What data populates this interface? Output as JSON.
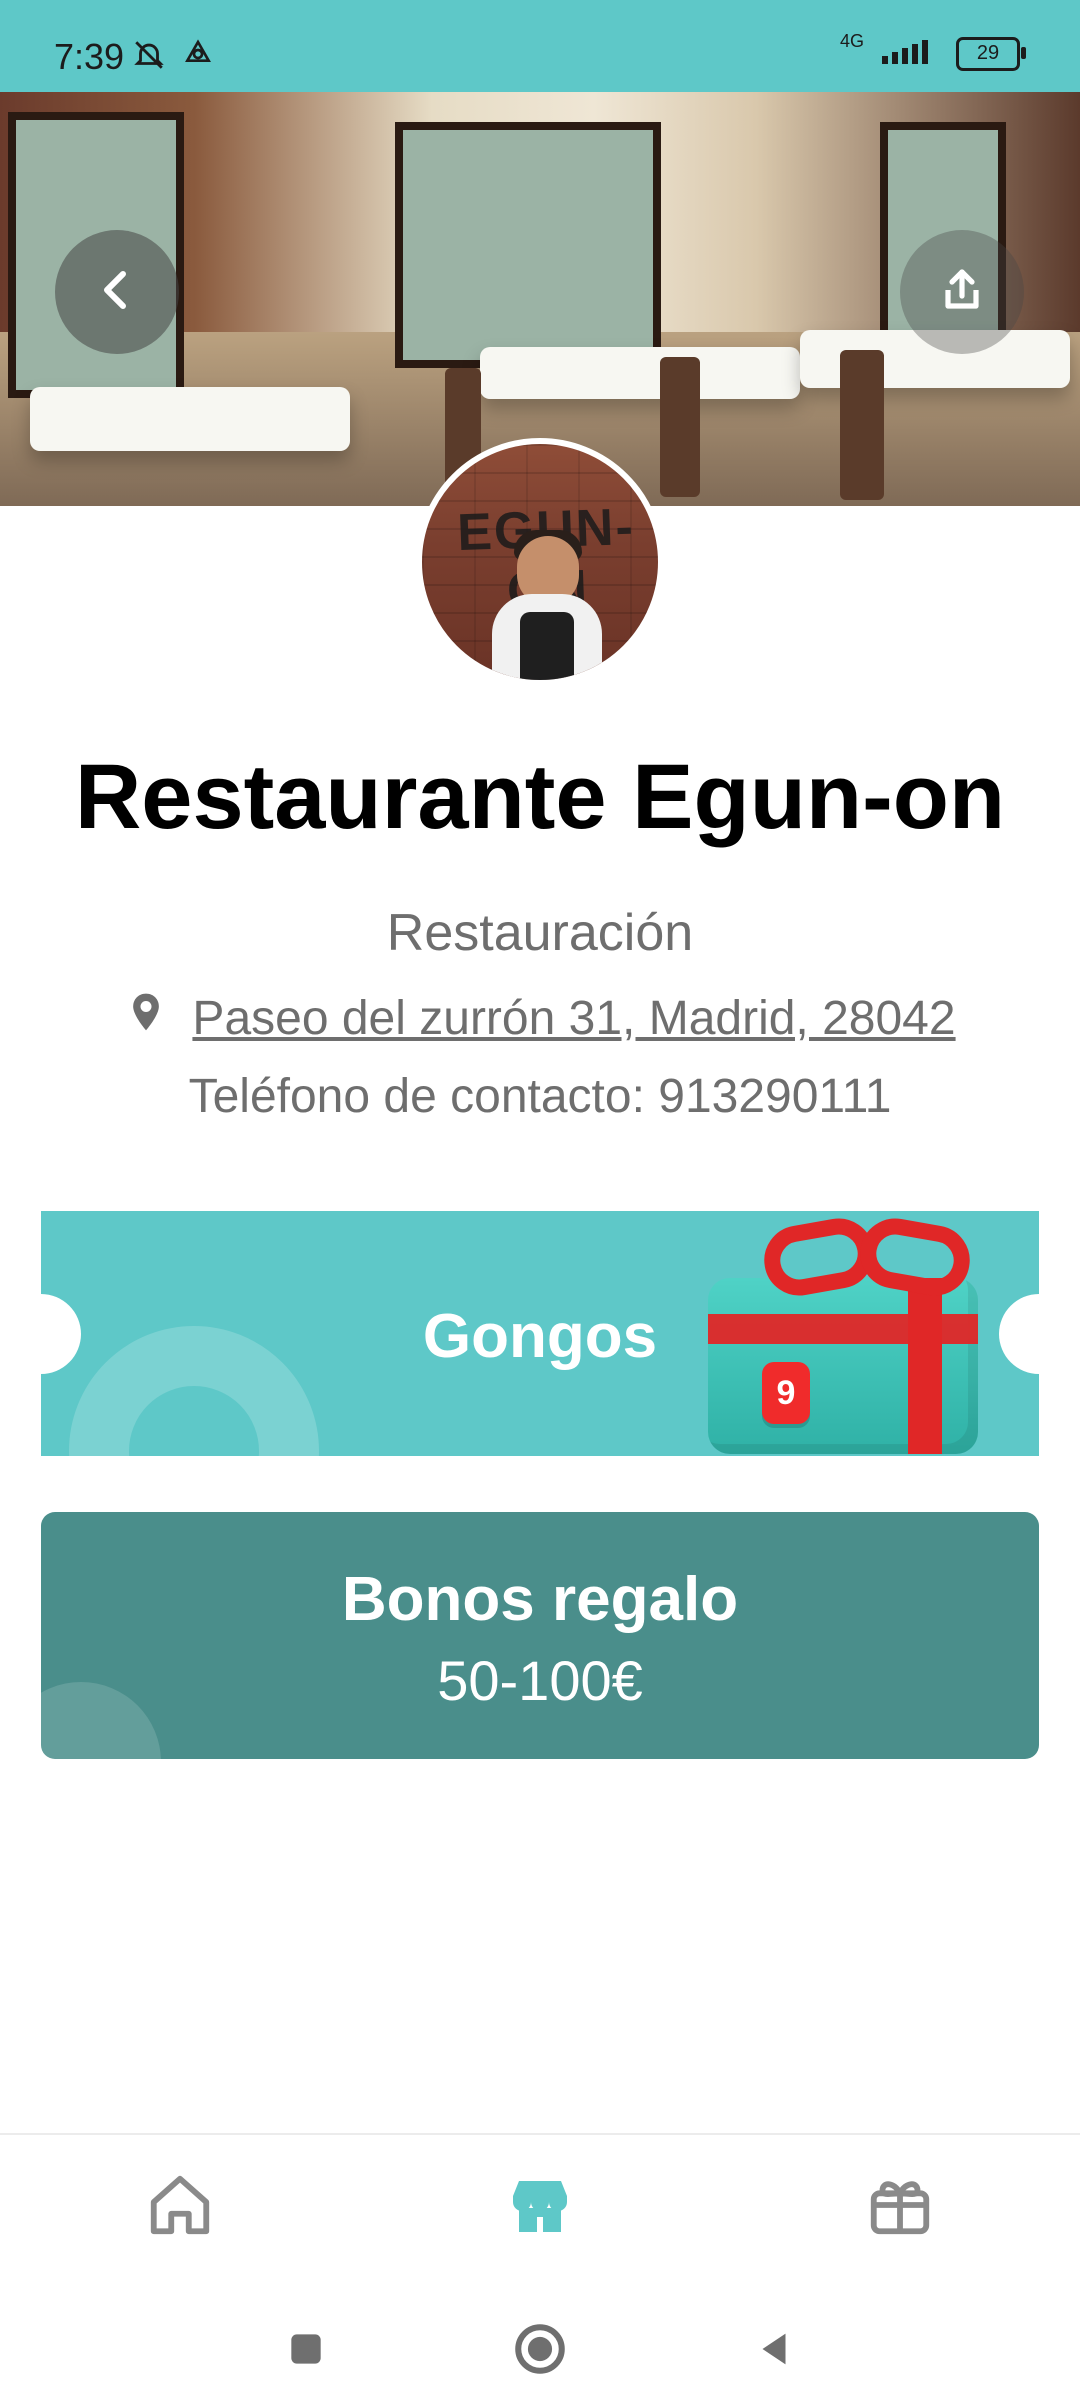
{
  "status_bar": {
    "time": "7:39",
    "network": "4G",
    "battery": "29"
  },
  "header": {
    "back_icon": "chevron-left-icon",
    "share_icon": "share-icon"
  },
  "restaurant": {
    "name": "Restaurante Egun-on",
    "category": "Restauración",
    "address": "Paseo del zurrón 31, Madrid, 28042",
    "phone": "Teléfono de contacto: 913290111"
  },
  "cards": {
    "gongos_label": "Gongos",
    "gift_badge": "9",
    "bonos_title": "Bonos regalo",
    "bonos_range": "50-100€"
  },
  "bottom_tabs": [
    {
      "name": "home",
      "icon": "home-icon",
      "active": false
    },
    {
      "name": "store",
      "icon": "store-icon",
      "active": true
    },
    {
      "name": "gifts",
      "icon": "gift-icon",
      "active": false
    }
  ],
  "colors": {
    "accent": "#5ec8c8",
    "bonos_bg": "#4a8e8b",
    "text_muted": "#6e6e6e"
  }
}
